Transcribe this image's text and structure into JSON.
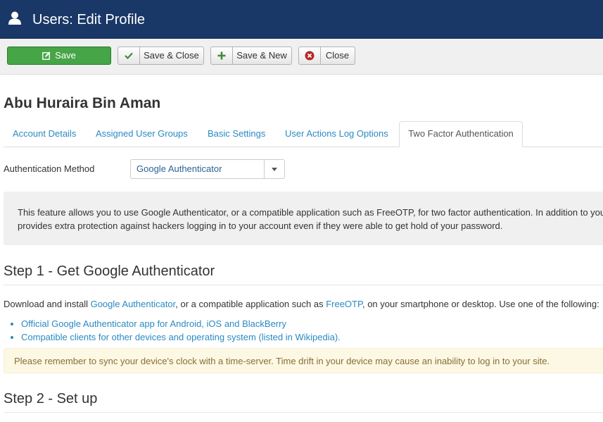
{
  "header": {
    "title": "Users: Edit Profile",
    "icon": "user-icon"
  },
  "toolbar": {
    "save_label": "Save",
    "save_close_label": "Save & Close",
    "save_new_label": "Save & New",
    "close_label": "Close"
  },
  "colors": {
    "header_bg": "#1a3867",
    "save_green": "#46a546",
    "link_blue": "#2a8ac2",
    "warning_bg": "#fcf8e3"
  },
  "profile": {
    "name": "Abu Huraira Bin Aman"
  },
  "tabs": [
    {
      "label": "Account Details"
    },
    {
      "label": "Assigned User Groups"
    },
    {
      "label": "Basic Settings"
    },
    {
      "label": "User Actions Log Options"
    },
    {
      "label": "Two Factor Authentication",
      "active": true
    }
  ],
  "auth": {
    "label": "Authentication Method",
    "selected": "Google Authenticator"
  },
  "info": {
    "line1": "This feature allows you to use Google Authenticator, or a compatible application such as FreeOTP, for two factor authentication. In addition to you",
    "line2": "provides extra protection against hackers logging in to your account even if they were able to get hold of your password."
  },
  "step1": {
    "title": "Step 1 - Get Google Authenticator",
    "download_prefix": "Download and install ",
    "google_auth_link": "Google Authenticator",
    "download_middle": ", or a compatible application such as ",
    "freeotp_link": "FreeOTP",
    "download_suffix": ", on your smartphone or desktop. Use one of the following:",
    "links": [
      "Official Google Authenticator app for Android, iOS and BlackBerry",
      "Compatible clients for other devices and operating system (listed in Wikipedia)."
    ],
    "warning": "Please remember to sync your device's clock with a time-server. Time drift in your device may cause an inability to log in to your site."
  },
  "step2": {
    "title": "Step 2 - Set up"
  }
}
